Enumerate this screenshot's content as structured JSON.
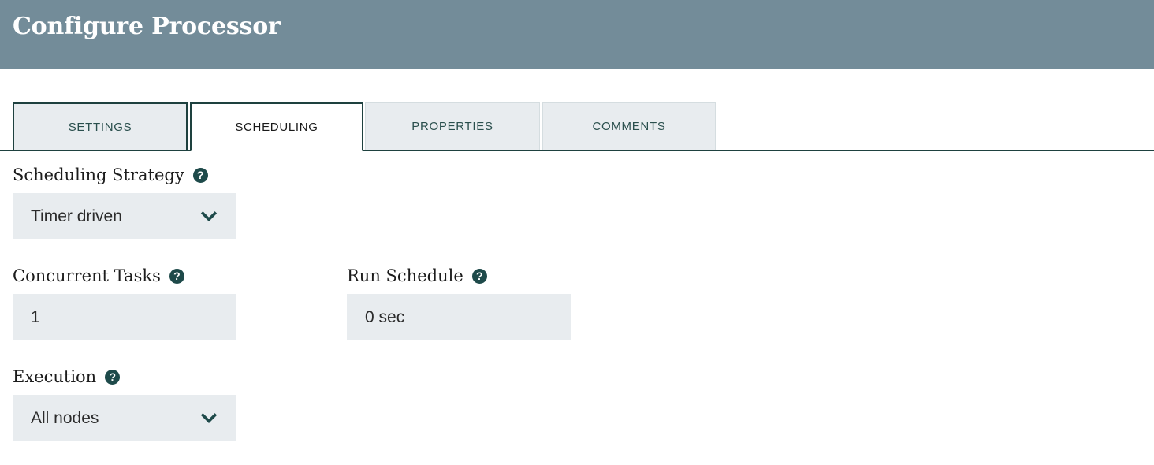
{
  "dialog": {
    "title": "Configure Processor",
    "header_bg": "#738c99",
    "accent": "#1e4a4a",
    "control_bg": "#e8ecef"
  },
  "tabs": [
    {
      "label": "SETTINGS",
      "active": false
    },
    {
      "label": "SCHEDULING",
      "active": true
    },
    {
      "label": "PROPERTIES",
      "active": false
    },
    {
      "label": "COMMENTS",
      "active": false
    }
  ],
  "form": {
    "scheduling_strategy": {
      "label": "Scheduling Strategy",
      "help_glyph": "?",
      "value": "Timer driven",
      "chevron": "chevron-down-icon"
    },
    "concurrent_tasks": {
      "label": "Concurrent Tasks",
      "help_glyph": "?",
      "value": "1"
    },
    "run_schedule": {
      "label": "Run Schedule",
      "help_glyph": "?",
      "value": "0 sec"
    },
    "execution": {
      "label": "Execution",
      "help_glyph": "?",
      "value": "All nodes",
      "chevron": "chevron-down-icon"
    }
  }
}
